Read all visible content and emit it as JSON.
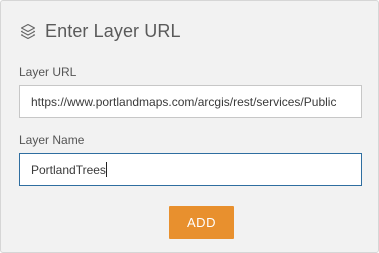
{
  "header": {
    "icon": "layers-icon",
    "title": "Enter Layer URL"
  },
  "fields": {
    "layer_url": {
      "label": "Layer URL",
      "value": "https://www.portlandmaps.com/arcgis/rest/services/Public"
    },
    "layer_name": {
      "label": "Layer Name",
      "value": "PortlandTrees"
    }
  },
  "actions": {
    "add_label": "ADD"
  },
  "colors": {
    "panel_background": "#f2f2f2",
    "accent_button": "#e8902e",
    "focused_border": "#2f6ea0"
  }
}
